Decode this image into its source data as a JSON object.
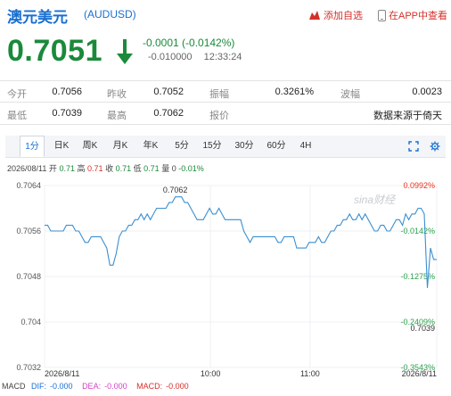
{
  "header": {
    "title": "澳元美元",
    "code": "(AUDUSD)",
    "favorite_label": "添加自选",
    "app_label": "在APP中查看"
  },
  "price": {
    "last": "0.7051",
    "change": "-0.0001 (-0.0142%)",
    "change_abs": "-0.010000",
    "time": "12:33:24",
    "direction": "down"
  },
  "quote": {
    "rows": [
      [
        {
          "label": "今开",
          "value": "0.7056"
        },
        {
          "label": "昨收",
          "value": "0.7052"
        },
        {
          "label": "振幅",
          "value": "0.3261%"
        },
        {
          "label": "波幅",
          "value": "0.0023"
        }
      ],
      [
        {
          "label": "最低",
          "value": "0.7039"
        },
        {
          "label": "最高",
          "value": "0.7062"
        },
        {
          "label": "报价",
          "value": "数据来源于倚天"
        }
      ]
    ]
  },
  "tabs": {
    "items": [
      "1分",
      "日K",
      "周K",
      "月K",
      "年K",
      "5分",
      "15分",
      "30分",
      "60分",
      "4H"
    ],
    "active": 0
  },
  "ohlc": {
    "date": "2026/08/11",
    "open_label": "开",
    "open": "0.71",
    "high_label": "高",
    "high": "0.71",
    "close_label": "收",
    "close": "0.71",
    "low_label": "低",
    "low": "0.71",
    "vol_label": "量",
    "vol": "0",
    "pct": "-0.01%"
  },
  "chart_data": {
    "type": "line",
    "title": "",
    "y_ticks": [
      "0.7064",
      "0.7056",
      "0.7048",
      "0.704",
      "0.7032"
    ],
    "y_tick_values": [
      0.7064,
      0.7056,
      0.7048,
      0.704,
      0.7032
    ],
    "ylim": [
      0.7032,
      0.7064
    ],
    "pct_ticks": [
      "0.0992%",
      "-0.0142%",
      "-0.1275%",
      "-0.2409%",
      "-0.3543%"
    ],
    "pct_colors": [
      "#e8331c",
      "#2aa34a",
      "#2aa34a",
      "#2aa34a",
      "#2aa34a"
    ],
    "x_ticks": [
      "2026/8/11",
      "10:00",
      "11:00",
      "2026/8/11"
    ],
    "x_tick_positions": [
      0,
      0.423,
      0.677,
      1
    ],
    "high_label": "0.7062",
    "low_label": "0.7039",
    "watermark": "sina财经",
    "line_color": "#3a8fd0",
    "values": [
      0.7057,
      0.7057,
      0.7056,
      0.7056,
      0.7056,
      0.7056,
      0.7056,
      0.7057,
      0.7057,
      0.7057,
      0.7056,
      0.7056,
      0.7055,
      0.7054,
      0.7054,
      0.7055,
      0.7055,
      0.7055,
      0.7055,
      0.7054,
      0.7053,
      0.705,
      0.705,
      0.7052,
      0.7055,
      0.7056,
      0.7056,
      0.7057,
      0.7057,
      0.7058,
      0.7058,
      0.7059,
      0.7058,
      0.7059,
      0.7058,
      0.7059,
      0.706,
      0.706,
      0.706,
      0.706,
      0.7061,
      0.7061,
      0.7062,
      0.7062,
      0.7062,
      0.7061,
      0.7061,
      0.706,
      0.7059,
      0.7058,
      0.7058,
      0.7058,
      0.7059,
      0.706,
      0.7059,
      0.7059,
      0.706,
      0.7059,
      0.7058,
      0.7058,
      0.7058,
      0.7058,
      0.7058,
      0.7058,
      0.7056,
      0.7055,
      0.7054,
      0.7055,
      0.7055,
      0.7055,
      0.7055,
      0.7055,
      0.7055,
      0.7055,
      0.7055,
      0.7054,
      0.7054,
      0.7055,
      0.7055,
      0.7055,
      0.7055,
      0.7053,
      0.7053,
      0.7053,
      0.7053,
      0.7054,
      0.7054,
      0.7054,
      0.7055,
      0.7054,
      0.7054,
      0.7055,
      0.7056,
      0.7056,
      0.7057,
      0.7057,
      0.7058,
      0.7058,
      0.7059,
      0.7058,
      0.7058,
      0.7059,
      0.7058,
      0.7059,
      0.7058,
      0.7057,
      0.7056,
      0.7056,
      0.7057,
      0.7057,
      0.7056,
      0.7056,
      0.7057,
      0.7058,
      0.7058,
      0.7057,
      0.7059,
      0.7058,
      0.7059,
      0.7059,
      0.706,
      0.706,
      0.7059,
      0.7046,
      0.7053,
      0.7051,
      0.7051
    ]
  },
  "macd": {
    "label": "MACD",
    "dif_label": "DIF:",
    "dif": "-0.000",
    "dea_label": "DEA:",
    "dea": "-0.000",
    "macd_label": "MACD:",
    "macd": "-0.000",
    "dif_color": "#1a6fd1",
    "dea_color": "#d43fc6",
    "macd_color": "#d4302a"
  }
}
